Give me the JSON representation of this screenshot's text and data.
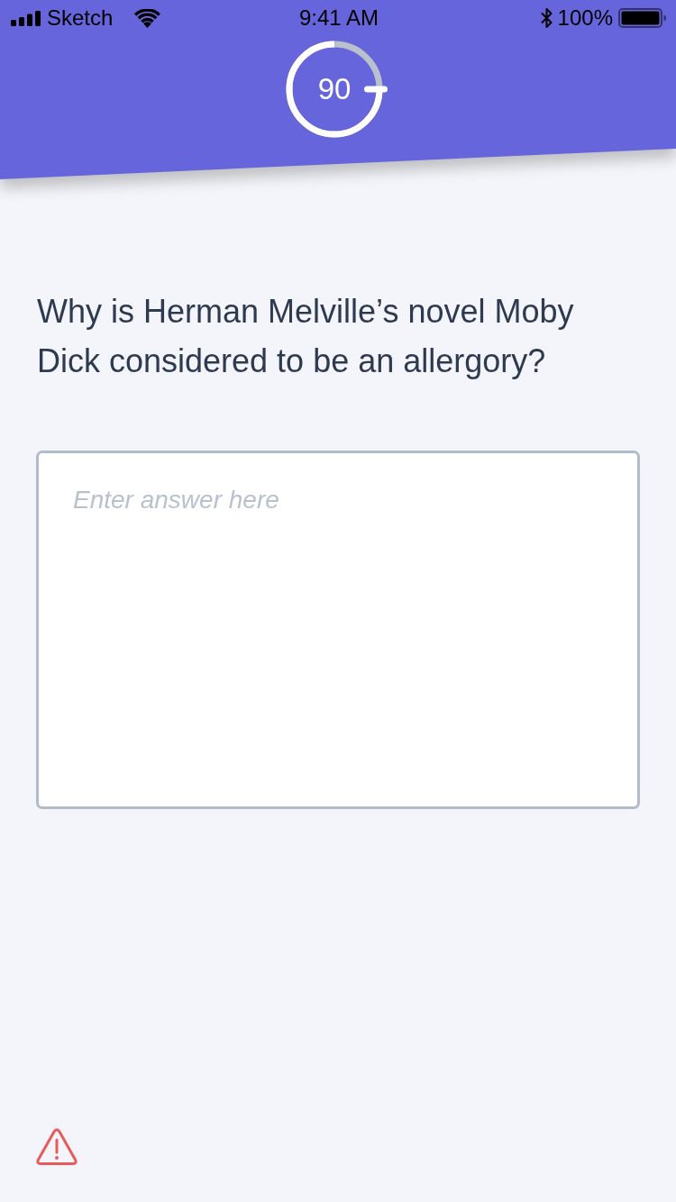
{
  "status_bar": {
    "carrier": "Sketch",
    "time": "9:41 AM",
    "battery": "100%"
  },
  "timer": {
    "value": "90",
    "level": 0.75
  },
  "question": "Why is Herman Melville’s novel Moby Dick considered to be an allergory?",
  "answer": {
    "placeholder": "Enter answer here"
  }
}
